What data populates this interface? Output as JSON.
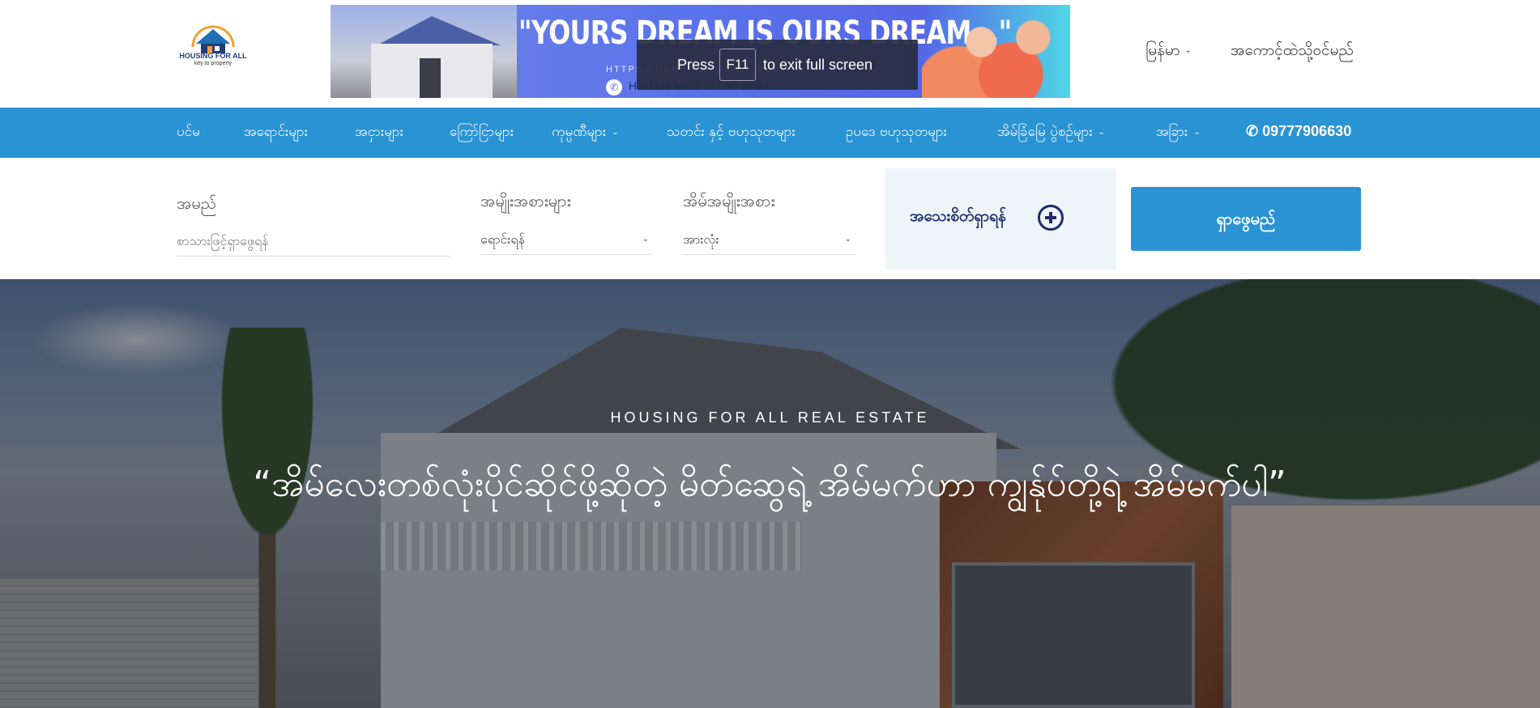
{
  "header": {
    "logo_text": "HOUSING FOR ALL",
    "logo_sub": "key to property",
    "banner": {
      "title": "\"YOURS DREAM IS OURS DREAM...\"",
      "url": "HTTPS://HOUSINGFORALL.COM.MM",
      "hotline": "Hot Line +959 777 90 66 30"
    },
    "fullscreen_toast": {
      "press": "Press",
      "key": "F11",
      "rest": "to exit full screen"
    },
    "language": "မြန်မာ",
    "register": "အကောင့်ထဲသို့ဝင်မည်"
  },
  "nav": {
    "items": [
      {
        "label": "ပင်မ"
      },
      {
        "label": "အရောင်းများ"
      },
      {
        "label": "အငှားများ"
      },
      {
        "label": "ကြော်ငြာများ"
      },
      {
        "label": "ကုမ္ပဏီများ"
      },
      {
        "label": "သတင်း နှင့် ဗဟုသုတများ"
      },
      {
        "label": "ဥပဒေ ဗဟုသုတများ"
      },
      {
        "label": "အိမ်ခြံမြေ ပွဲစဉ်များ"
      },
      {
        "label": "အခြား"
      }
    ],
    "phone": "09777906630"
  },
  "search": {
    "name_label": "အမည်",
    "name_placeholder": "စာသားဖြင့်ရှာဖွေရန်",
    "category_label": "အမျိုးအစားများ",
    "category_value": "ရောင်းရန်",
    "type_label": "အိမ်အမျိုးအစား",
    "type_value": "အားလုံး",
    "advanced_label": "အသေးစိတ်ရှာရန်",
    "search_button": "ရှာဖွေမည်"
  },
  "hero": {
    "kicker": "HOUSING FOR ALL REAL ESTATE",
    "title": "“အိမ်လေးတစ်လုံးပိုင်ဆိုင်ဖို့ဆိုတဲ့ မိတ်ဆွေရဲ့ အိမ်မက်ဟာ ကျွန်ုပ်တို့ရဲ့ အိမ်မက်ပါ”"
  },
  "colors": {
    "nav_bg": "#2a93d4",
    "accent_dark": "#1f2a6b",
    "advanced_bg": "#eef5f8"
  }
}
